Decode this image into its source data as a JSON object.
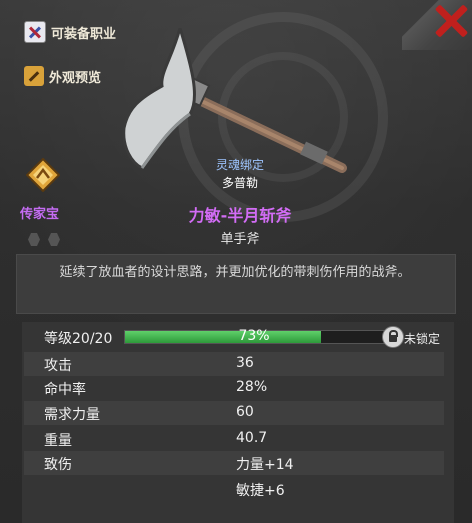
{
  "sidebar": {
    "equippable_classes": "可装备职业",
    "appearance_preview": "外观预览"
  },
  "item": {
    "rarity": "传家宝",
    "soulbound": "灵魂绑定",
    "owner": "多普勒",
    "name": "力敏-半月斩斧",
    "type": "单手斧",
    "description": "延续了放血者的设计思路，并更加优化的带刺伤作用的战斧。",
    "colors": {
      "rarity": "#c46cf2",
      "name": "#d26cf5",
      "soulbound": "#9ec5ff",
      "close": "#c0201d",
      "xp_bar": "#3fb04a"
    }
  },
  "level": {
    "label": "等级",
    "value": "20/20",
    "progress_text": "73%",
    "progress": 0.73,
    "lock_status": "未锁定"
  },
  "stats": [
    {
      "label": "攻击",
      "value": "36"
    },
    {
      "label": "命中率",
      "value": "28%"
    },
    {
      "label": "需求力量",
      "value": "60"
    },
    {
      "label": "重量",
      "value": "40.7"
    },
    {
      "label": "致伤",
      "value": "力量+14"
    },
    {
      "label": "",
      "value": "敏捷+6"
    }
  ],
  "icons": {
    "close": "close-icon",
    "class": "crossed-swords-icon",
    "preview": "hammer-icon",
    "legend": "heirloom-badge-icon",
    "lock": "lock-icon",
    "weapon": "axe-icon"
  }
}
